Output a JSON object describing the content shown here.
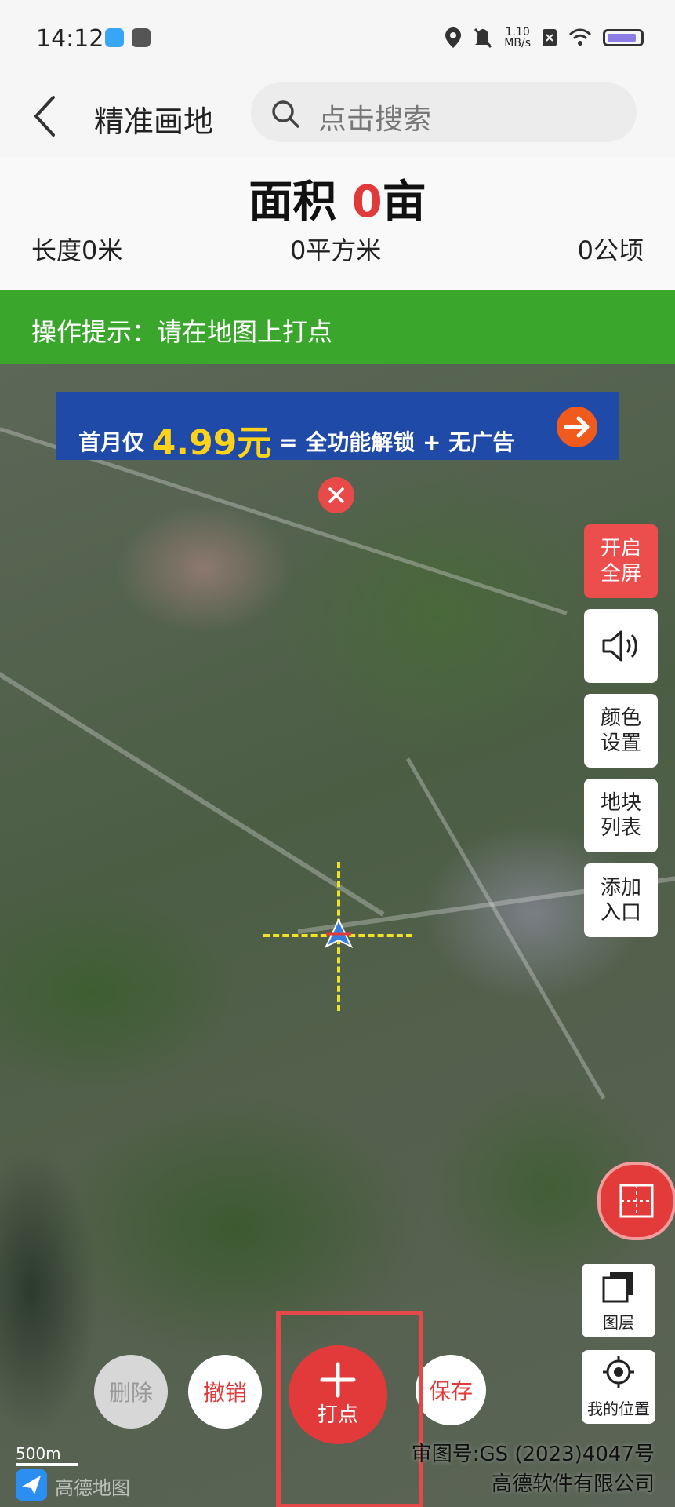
{
  "status": {
    "time": "14:12",
    "net_speed_value": "1.10",
    "net_speed_unit": "MB/s"
  },
  "header": {
    "title": "精准画地",
    "search_placeholder": "点击搜索"
  },
  "summary": {
    "area_label": "面积",
    "area_value": "0",
    "area_unit": "亩",
    "length": "长度0米",
    "square_meters": "0平方米",
    "hectares": "0公顷"
  },
  "tip": {
    "text": "操作提示：请在地图上打点"
  },
  "promo": {
    "prefix": "首月仅",
    "price": "4.99元",
    "suffix": "= 全功能解锁 + 无广告"
  },
  "side_buttons": {
    "fullscreen": [
      "开启",
      "全屏"
    ],
    "color": [
      "颜色",
      "设置"
    ],
    "plots": [
      "地块",
      "列表"
    ],
    "add_entry": [
      "添加",
      "入口"
    ],
    "layers": "图层",
    "my_location": "我的位置"
  },
  "actions": {
    "delete": "删除",
    "undo": "撤销",
    "add_point": "打点",
    "save": "保存"
  },
  "map": {
    "scale": "500m",
    "logo": "高德地图",
    "review_number": "审图号:GS (2023)4047号",
    "company": "高德软件有限公司"
  },
  "colors": {
    "accent_red": "#e23a3a",
    "tip_green": "#3aa72c",
    "promo_blue": "#1f4aa8"
  }
}
